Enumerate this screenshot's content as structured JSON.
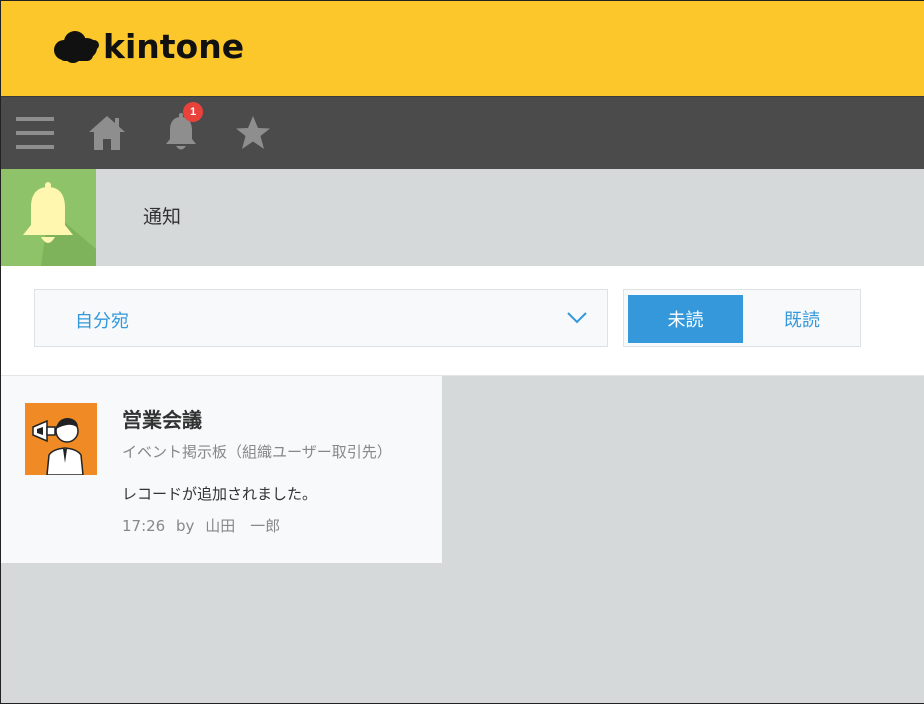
{
  "header": {
    "logo_text": "kintone"
  },
  "nav": {
    "menu_icon": "hamburger-menu-icon",
    "home_icon": "home-icon",
    "notification_icon": "bell-icon",
    "notification_badge": "1",
    "favorites_icon": "star-icon"
  },
  "page": {
    "icon": "bell-icon",
    "title": "通知"
  },
  "filter": {
    "recipient_value": "自分宛",
    "unread_label": "未読",
    "read_label": "既読"
  },
  "notifications": [
    {
      "title": "営業会議",
      "app": "イベント掲示板（組織ユーザー取引先）",
      "message": "レコードが追加されました。",
      "time": "17:26",
      "by": "by",
      "author": "山田　一郎"
    }
  ],
  "colors": {
    "brand_yellow": "#fcc72b",
    "nav_dark": "#4b4b4b",
    "accent_blue": "#3498db",
    "page_icon_green": "#8fc36a",
    "avatar_orange": "#f08a24",
    "badge_red": "#e8423b"
  }
}
